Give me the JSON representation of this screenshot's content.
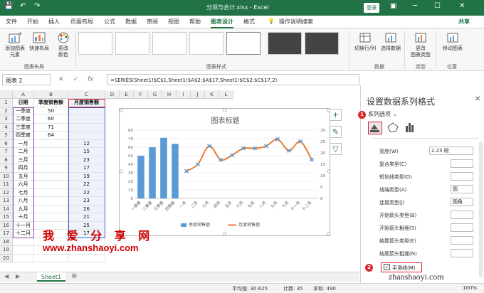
{
  "titlebar": {
    "title": "分项与合计.xlsx  -  Excel",
    "login": "登录",
    "undo": "↶",
    "redo": "↷",
    "save": "💾",
    "minimize": "─",
    "maximize": "☐",
    "close": "✕",
    "ribbon_display": "▣"
  },
  "tabs": [
    "文件",
    "开始",
    "插入",
    "页面布局",
    "公式",
    "数据",
    "审阅",
    "视图",
    "帮助",
    "图表设计",
    "格式"
  ],
  "tell_me": "操作说明搜索",
  "share": "共享",
  "ribbon": {
    "add_element": "添加图表\n元素",
    "quick_layout": "快速布局",
    "change_colors": "更改\n颜色",
    "group_layout": "图表布局",
    "group_styles": "图表样式",
    "switch_row_col": "切换行/列",
    "select_data": "选择数据",
    "group_data": "数据",
    "change_type": "更改\n图表类型",
    "group_type": "类型",
    "move_chart": "移动图表",
    "group_location": "位置"
  },
  "formula_bar": {
    "name_box": "图表 2",
    "cancel": "✕",
    "enter": "✓",
    "fx": "fx",
    "formula": "=SERIES(Sheet1!$C$1,Sheet1!$A$2:$A$17,Sheet1!$C$2:$C$17,2)"
  },
  "grid": {
    "columns": [
      "A",
      "B",
      "C",
      "D",
      "E",
      "F",
      "G",
      "H",
      "I",
      "J",
      "K",
      "L"
    ],
    "rows": [
      [
        "日期",
        "季度销售额",
        "月度销售额"
      ],
      [
        "一季度",
        "50",
        ""
      ],
      [
        "二季度",
        "60",
        ""
      ],
      [
        "三季度",
        "71",
        ""
      ],
      [
        "四季度",
        "64",
        ""
      ],
      [
        "一月",
        "",
        "12"
      ],
      [
        "二月",
        "",
        "15"
      ],
      [
        "三月",
        "",
        "23"
      ],
      [
        "四月",
        "",
        "17"
      ],
      [
        "五月",
        "",
        "19"
      ],
      [
        "六月",
        "",
        "22"
      ],
      [
        "七月",
        "",
        "22"
      ],
      [
        "八月",
        "",
        "23"
      ],
      [
        "九月",
        "",
        "26"
      ],
      [
        "十月",
        "",
        "21"
      ],
      [
        "十一月",
        "",
        "25"
      ],
      [
        "十二月",
        "",
        "17"
      ]
    ]
  },
  "chart_data": {
    "type": "bar",
    "title": "图表标题",
    "categories": [
      "一季度",
      "二季度",
      "三季度",
      "四季度",
      "一月",
      "二月",
      "三月",
      "四月",
      "五月",
      "六月",
      "七月",
      "八月",
      "九月",
      "十月",
      "十一月",
      "十二月"
    ],
    "series": [
      {
        "name": "季度销售额",
        "type": "bar",
        "axis": "left",
        "color": "#5b9bd5",
        "values": [
          50,
          60,
          71,
          64,
          null,
          null,
          null,
          null,
          null,
          null,
          null,
          null,
          null,
          null,
          null,
          null
        ]
      },
      {
        "name": "月度销售额",
        "type": "line",
        "axis": "right",
        "color": "#ed7d31",
        "smooth": true,
        "values": [
          null,
          null,
          null,
          null,
          12,
          15,
          23,
          17,
          19,
          22,
          22,
          23,
          26,
          21,
          25,
          17
        ]
      }
    ],
    "y_left": {
      "min": 0,
      "max": 80,
      "ticks": [
        "0",
        "10",
        "20",
        "30",
        "40",
        "50",
        "60",
        "70",
        "80"
      ]
    },
    "y_right": {
      "min": 0,
      "max": 30,
      "ticks": [
        "0",
        "5",
        "10",
        "15",
        "20",
        "25",
        "30"
      ]
    },
    "legend_position": "bottom",
    "grid": true
  },
  "chart_side_buttons": [
    "+",
    "✎",
    "▽"
  ],
  "watermark": {
    "line1": "我 爱 分 享 网",
    "line2": "www.zhanshaoyi.com",
    "line3": "zhanshaoyi.com"
  },
  "sheet": {
    "name": "Sheet1",
    "add": "⊕"
  },
  "status": {
    "average": "平均值: 30.625",
    "count": "计数: 35",
    "sum": "求和: 490",
    "zoom": "100%"
  },
  "pane": {
    "title": "设置数据系列格式",
    "series_options": "系列选项",
    "badge1": "1",
    "badge2": "2",
    "rows": [
      {
        "label": "宽度(W)",
        "value": "2.25 磅"
      },
      {
        "label": "复合类型(C)",
        "value": ""
      },
      {
        "label": "短划线类型(D)",
        "value": ""
      },
      {
        "label": "线端类型(A)",
        "value": "圆"
      },
      {
        "label": "连接类型(J)",
        "value": "圆角"
      },
      {
        "label": "开始箭头类型(B)",
        "value": ""
      },
      {
        "label": "开始箭头粗细(S)",
        "value": ""
      },
      {
        "label": "结尾箭头类型(E)",
        "value": ""
      },
      {
        "label": "结尾箭头粗细(N)",
        "value": ""
      }
    ],
    "smooth_line": "平滑线(M)"
  }
}
